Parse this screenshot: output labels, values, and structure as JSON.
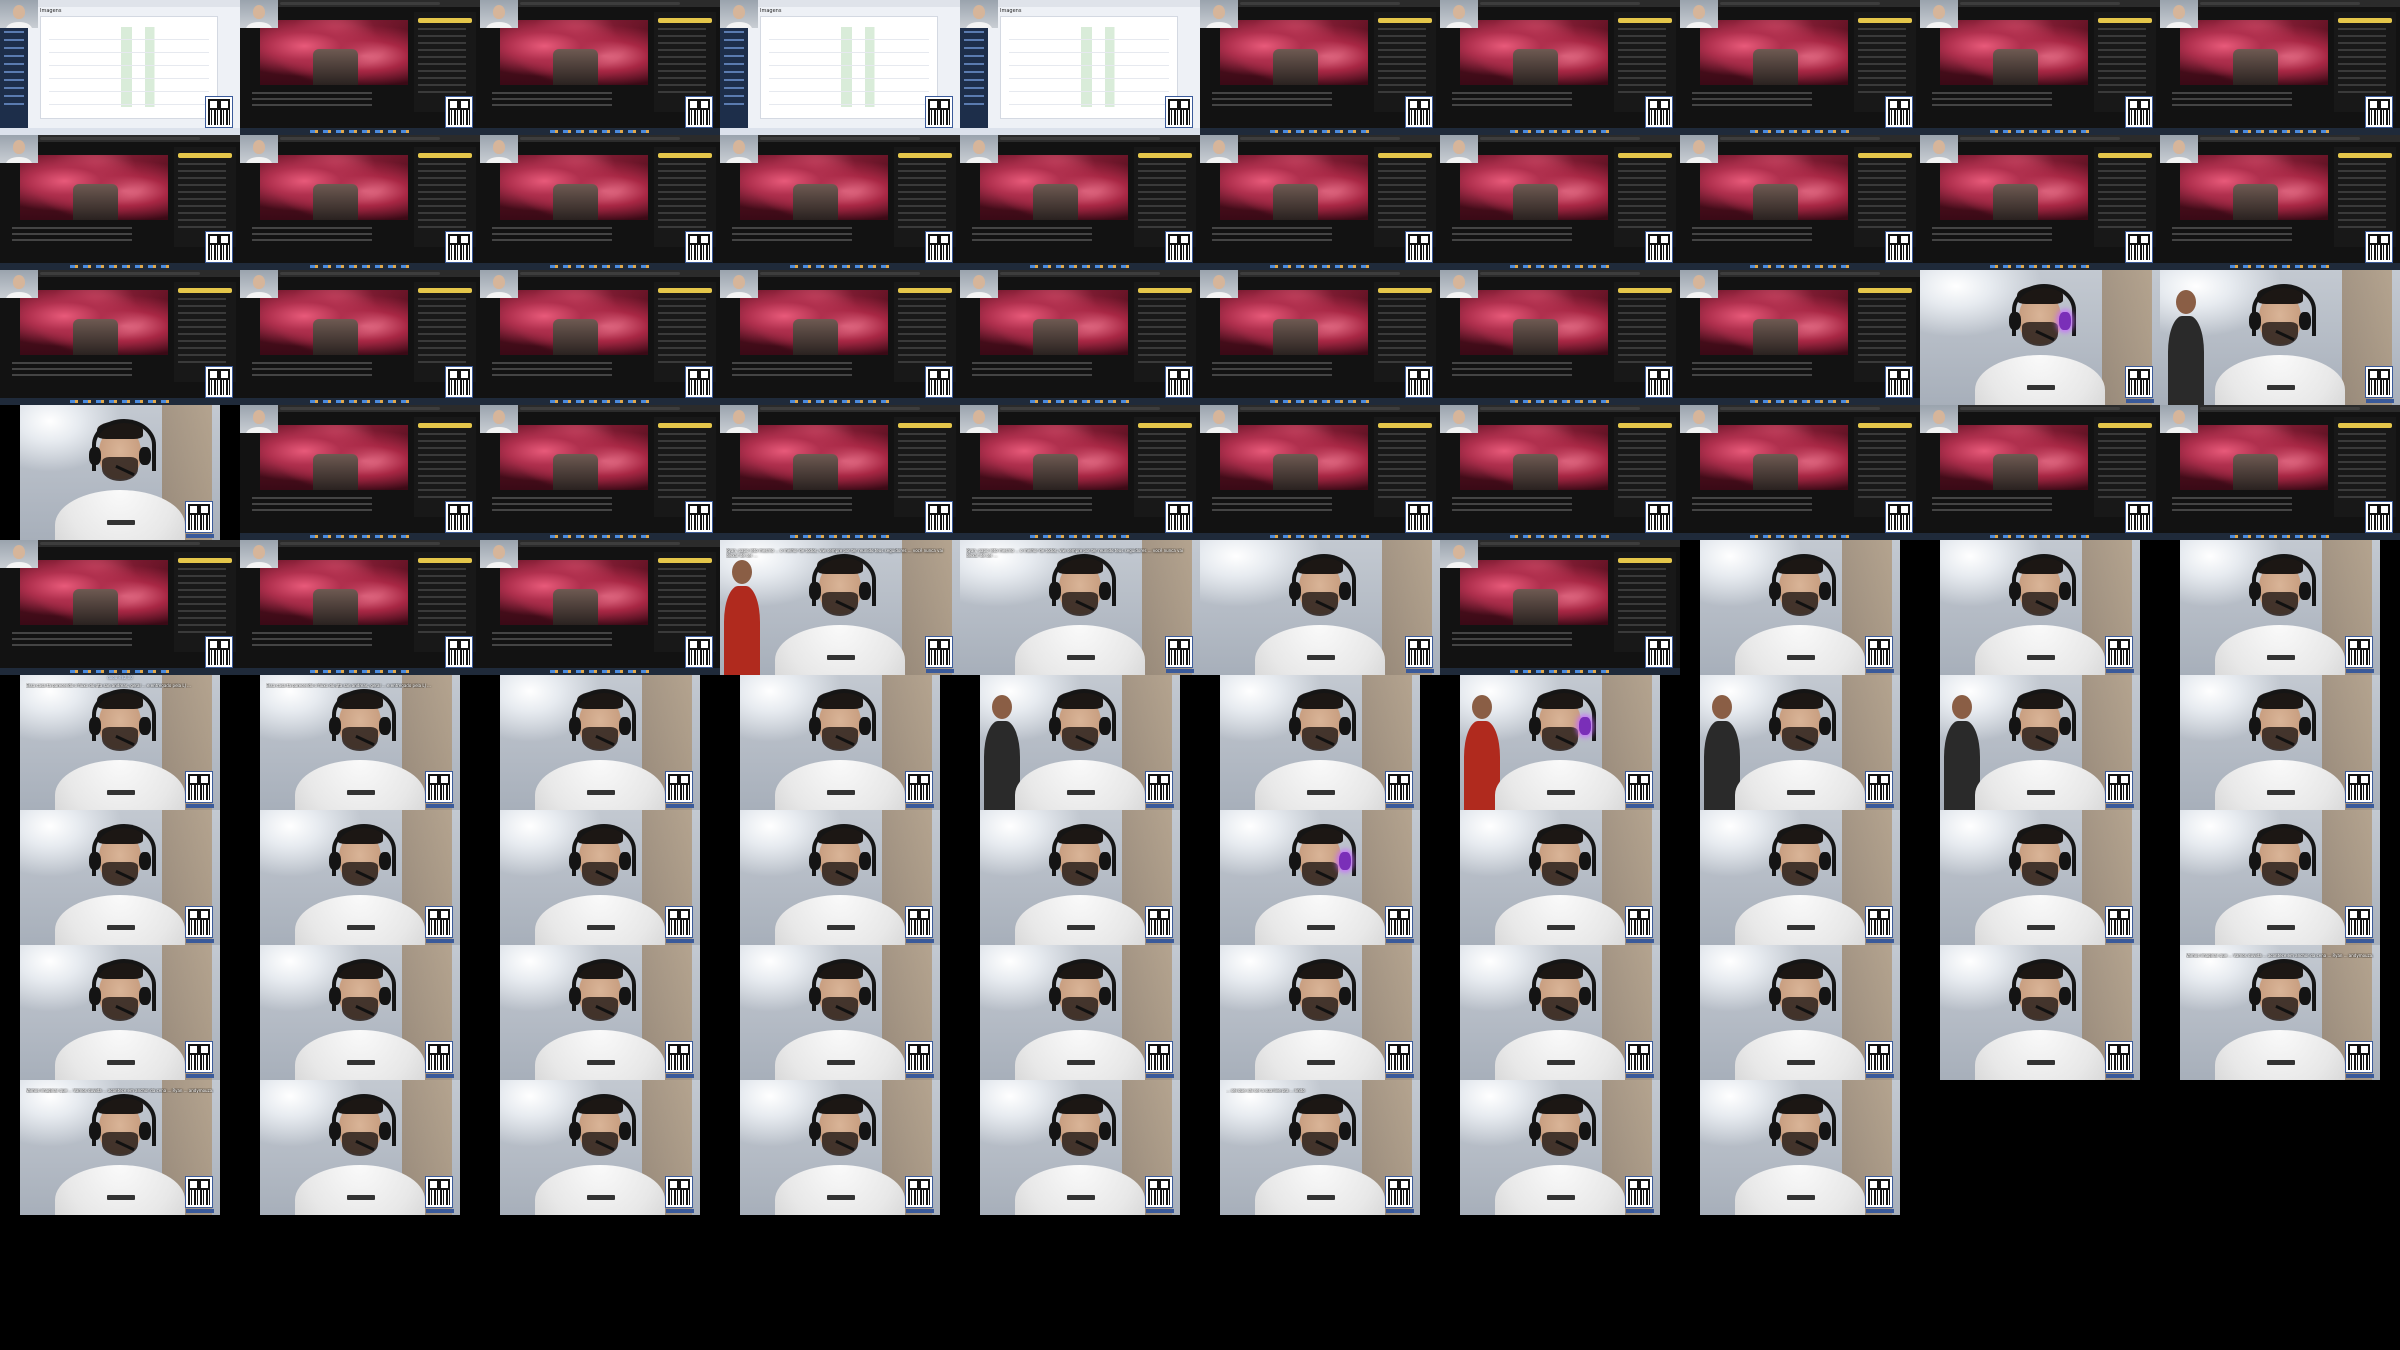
{
  "grid": {
    "columns": 10,
    "rows": 10,
    "frames": [
      {
        "type": "screen-light",
        "title": "Imagens",
        "inset": "cam"
      },
      {
        "type": "screen-dark",
        "inset": "cam"
      },
      {
        "type": "screen-dark",
        "inset": "cam"
      },
      {
        "type": "screen-light",
        "title": "Imagens",
        "inset": "cam"
      },
      {
        "type": "screen-light",
        "title": "Imagens",
        "inset": "cam"
      },
      {
        "type": "screen-dark",
        "inset": "cam"
      },
      {
        "type": "screen-dark",
        "inset": "cam"
      },
      {
        "type": "screen-dark",
        "inset": "cam"
      },
      {
        "type": "screen-dark",
        "inset": "cam"
      },
      {
        "type": "screen-dark",
        "inset": "cam"
      },
      {
        "type": "screen-dark",
        "inset": "cam"
      },
      {
        "type": "screen-dark",
        "inset": "cam"
      },
      {
        "type": "screen-dark",
        "inset": "cam"
      },
      {
        "type": "screen-dark",
        "inset": "cam"
      },
      {
        "type": "screen-dark",
        "inset": "cam"
      },
      {
        "type": "screen-dark",
        "inset": "cam"
      },
      {
        "type": "screen-dark",
        "inset": "cam"
      },
      {
        "type": "screen-dark",
        "inset": "cam"
      },
      {
        "type": "screen-dark",
        "inset": "cam"
      },
      {
        "type": "screen-dark",
        "inset": "cam"
      },
      {
        "type": "screen-dark",
        "inset": "cam"
      },
      {
        "type": "screen-dark",
        "inset": "cam"
      },
      {
        "type": "screen-dark",
        "inset": "cam"
      },
      {
        "type": "screen-dark",
        "inset": "cam"
      },
      {
        "type": "screen-dark",
        "inset": "cam"
      },
      {
        "type": "screen-dark",
        "inset": "cam"
      },
      {
        "type": "screen-dark",
        "inset": "cam"
      },
      {
        "type": "screen-dark",
        "inset": "cam"
      },
      {
        "type": "webcam",
        "glow": true
      },
      {
        "type": "webcam",
        "extra": "companion"
      },
      {
        "type": "webcam",
        "pad": true
      },
      {
        "type": "screen-dark",
        "inset": "cam"
      },
      {
        "type": "screen-dark",
        "inset": "cam"
      },
      {
        "type": "screen-dark",
        "inset": "cam"
      },
      {
        "type": "screen-dark",
        "inset": "cam"
      },
      {
        "type": "screen-dark",
        "inset": "cam"
      },
      {
        "type": "screen-dark",
        "inset": "cam"
      },
      {
        "type": "screen-dark",
        "inset": "cam"
      },
      {
        "type": "screen-dark",
        "inset": "cam"
      },
      {
        "type": "screen-dark",
        "inset": "cam"
      },
      {
        "type": "screen-dark",
        "inset": "cam"
      },
      {
        "type": "screen-dark",
        "inset": "cam"
      },
      {
        "type": "screen-dark",
        "inset": "cam"
      },
      {
        "type": "webcam",
        "extra": "side-red",
        "donation": "Ryan, papo reto mesmo ... o melhor de todos, vlw sempre por ter reunido teus seguidores ... você nunca vai deixar de ser ..."
      },
      {
        "type": "webcam",
        "donation": "Ryan, papo reto mesmo ... o melhor de todos, vlw sempre por ter reunido teus seguidores ... você nunca vai deixar de ser ..."
      },
      {
        "type": "webcam"
      },
      {
        "type": "screen-dark",
        "inset": "cam"
      },
      {
        "type": "webcam",
        "pad": true
      },
      {
        "type": "webcam",
        "pad": true
      },
      {
        "type": "webcam",
        "pad": true
      },
      {
        "type": "webcam",
        "pad": true,
        "donation_header": "doou R$2,00",
        "donation": "Essa casa tá parecendo o fluxo do gta san andreas, geral ... e entregado pela LJ ..."
      },
      {
        "type": "webcam",
        "pad": true,
        "donation": "Essa casa tá parecendo o fluxo do gta san andreas, geral ... e entregado pela LJ ..."
      },
      {
        "type": "webcam",
        "pad": true
      },
      {
        "type": "webcam",
        "pad": true
      },
      {
        "type": "webcam",
        "pad": true,
        "extra": "side-dark"
      },
      {
        "type": "webcam",
        "pad": true
      },
      {
        "type": "webcam",
        "pad": true,
        "glow": true,
        "extra": "side-red"
      },
      {
        "type": "webcam",
        "pad": true,
        "extra": "side-dark"
      },
      {
        "type": "webcam",
        "pad": true,
        "extra": "side-dark"
      },
      {
        "type": "webcam",
        "pad": true
      },
      {
        "type": "webcam",
        "pad": true
      },
      {
        "type": "webcam",
        "pad": true
      },
      {
        "type": "webcam",
        "pad": true
      },
      {
        "type": "webcam",
        "pad": true
      },
      {
        "type": "webcam",
        "pad": true
      },
      {
        "type": "webcam",
        "pad": true,
        "glow": true
      },
      {
        "type": "webcam",
        "pad": true
      },
      {
        "type": "webcam",
        "pad": true
      },
      {
        "type": "webcam",
        "pad": true
      },
      {
        "type": "webcam",
        "pad": true
      },
      {
        "type": "webcam",
        "pad": true
      },
      {
        "type": "webcam",
        "pad": true
      },
      {
        "type": "webcam",
        "pad": true
      },
      {
        "type": "webcam",
        "pad": true
      },
      {
        "type": "webcam",
        "pad": true
      },
      {
        "type": "webcam",
        "pad": true
      },
      {
        "type": "webcam",
        "pad": true
      },
      {
        "type": "webcam",
        "pad": true
      },
      {
        "type": "webcam",
        "pad": true
      },
      {
        "type": "webcam",
        "pad": true,
        "donation": "Vamos imaginar que ... Vamos duvida ... acontece em anchor da cena ... Ryan ... andymouza."
      },
      {
        "type": "webcam",
        "pad": true,
        "donation": "Vamos imaginar que ... Vamos duvida ... acontece em anchor da cena ... Ryan ... andymouza."
      },
      {
        "type": "webcam",
        "pad": true
      },
      {
        "type": "webcam",
        "pad": true
      },
      {
        "type": "webcam",
        "pad": true
      },
      {
        "type": "webcam",
        "pad": true
      },
      {
        "type": "webcam",
        "pad": true,
        "donation": "... sei que vai ser a sua live pra ... lindo"
      },
      {
        "type": "webcam",
        "pad": true
      },
      {
        "type": "webcam",
        "pad": true
      },
      {
        "type": "empty"
      },
      {
        "type": "empty"
      }
    ]
  },
  "colors": {
    "background": "#000000",
    "stage_red": "#b0304e",
    "qr_border": "#3a5a9a",
    "headset_glow": "#c86cff"
  },
  "icons": [
    "qr-code-icon",
    "headset-icon"
  ]
}
